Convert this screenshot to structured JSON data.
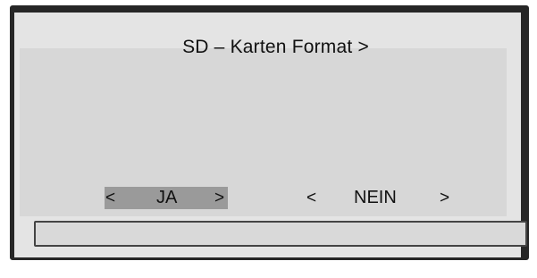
{
  "dialog": {
    "title": "SD – Karten Format >"
  },
  "options": {
    "yes": {
      "left_arrow": "<",
      "label": "JA",
      "right_arrow": ">",
      "selected": true
    },
    "no": {
      "left_arrow": "<",
      "label": "NEIN",
      "right_arrow": ">",
      "selected": false
    }
  },
  "progress": {
    "value": 0
  },
  "colors": {
    "frame": "#262626",
    "background": "#e4e4e4",
    "panel": "#d7d7d7",
    "selection": "#9a9a9a"
  }
}
